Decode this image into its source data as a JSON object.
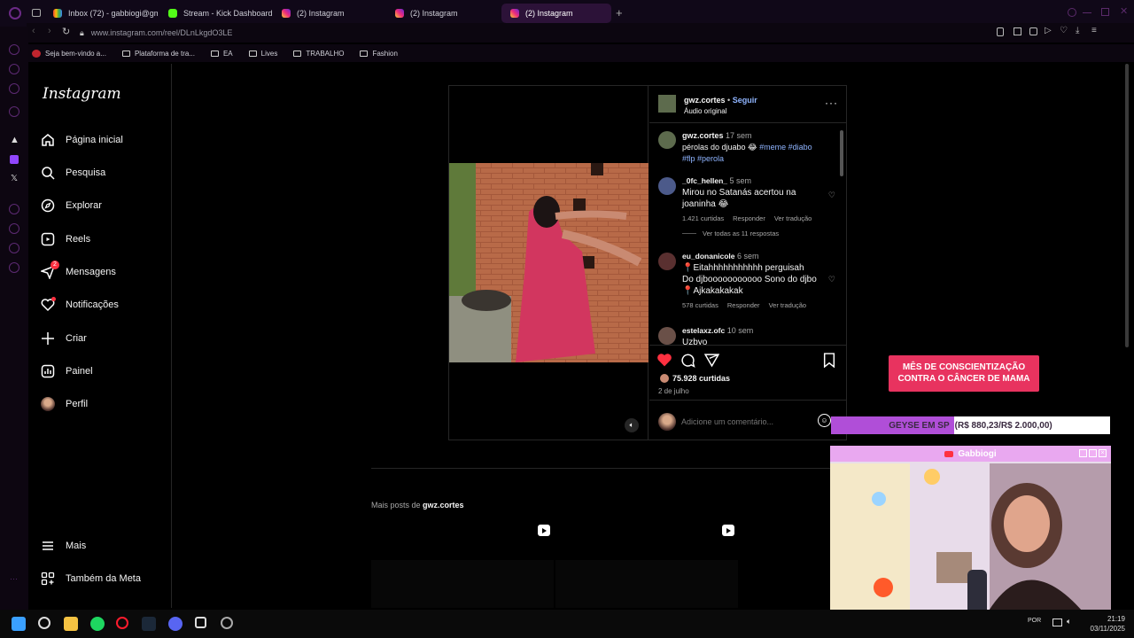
{
  "browser": {
    "tabs": [
      {
        "label": "Inbox (72) - gabbiogi@gm",
        "active": false
      },
      {
        "label": "Stream - Kick Dashboard",
        "active": false
      },
      {
        "label": "(2) Instagram",
        "active": false
      },
      {
        "label": "(2) Instagram",
        "active": false
      },
      {
        "label": "(2) Instagram",
        "active": true
      }
    ],
    "url": "www.instagram.com/reel/DLnLkgdO3LE",
    "bookmarks": [
      "Seja bem-vindo a...",
      "Plataforma de tra...",
      "EA",
      "Lives",
      "TRABALHO",
      "Fashion"
    ]
  },
  "instagram": {
    "logo": "Instagram",
    "nav": [
      {
        "label": "Página inicial",
        "icon": "home-icon"
      },
      {
        "label": "Pesquisa",
        "icon": "search-icon"
      },
      {
        "label": "Explorar",
        "icon": "compass-icon"
      },
      {
        "label": "Reels",
        "icon": "reels-icon"
      },
      {
        "label": "Mensagens",
        "icon": "messenger-icon",
        "badge": "2"
      },
      {
        "label": "Notificações",
        "icon": "heart-icon"
      },
      {
        "label": "Criar",
        "icon": "plus-icon"
      },
      {
        "label": "Painel",
        "icon": "dashboard-icon"
      },
      {
        "label": "Perfil",
        "icon": "profile-avatar"
      }
    ],
    "nav_bottom": [
      {
        "label": "Mais",
        "icon": "menu-icon"
      },
      {
        "label": "Também da Meta",
        "icon": "meta-grid-icon"
      }
    ],
    "post": {
      "author": "gwz.cortes",
      "follow_label": "Seguir",
      "separator": "•",
      "audio": "Áudio original",
      "caption": {
        "user": "gwz.cortes",
        "time": "17 sem",
        "text": "pérolas do djuabo 😂",
        "tags_line1": "#meme #diabo",
        "tags_line2": "#flp #perola"
      },
      "comments": [
        {
          "user": "_0fc_hellen_",
          "time": "5 sem",
          "text": "Mirou no Satanás acertou na joaninha 😂",
          "likes": "1.421 curtidas",
          "reply": "Responder",
          "translate": "Ver tradução",
          "view_replies": "Ver todas as 11 respostas"
        },
        {
          "user": "eu_donanicole",
          "time": "6 sem",
          "text": "📍Eitahhhhhhhhhhh perguisah Do djbooooooooooo Sono do djbo📍Ajkakakakak",
          "likes": "578 curtidas",
          "reply": "Responder",
          "translate": "Ver tradução"
        },
        {
          "user": "estelaxz.ofc",
          "time": "10 sem",
          "text": "Uzbyo"
        }
      ],
      "likes": "75.928 curtidas",
      "date": "2 de julho",
      "comment_placeholder": "Adicione um comentário...",
      "liked": true
    },
    "more_posts_prefix": "Mais posts de",
    "more_posts_user": "gwz.cortes"
  },
  "overlays": {
    "promo_line1": "MÊS DE CONSCIENTIZAÇÃO",
    "promo_line2": "CONTRA O CÂNCER DE MAMA",
    "goal_label": "GEYSE EM SP",
    "goal_value": "(R$ 880,23/R$ 2.000,00)",
    "goal_progress": 0.44,
    "cam_title": "Gabbiogi"
  },
  "taskbar": {
    "lang": "POR",
    "time": "21:19",
    "date": "03/11/2025"
  },
  "colors": {
    "instagram_link": "#8fb4ff",
    "like_red": "#ff3040",
    "tab_active": "#2c1238",
    "promo": "#e8335f",
    "goal_fill": "#b04ed8"
  }
}
